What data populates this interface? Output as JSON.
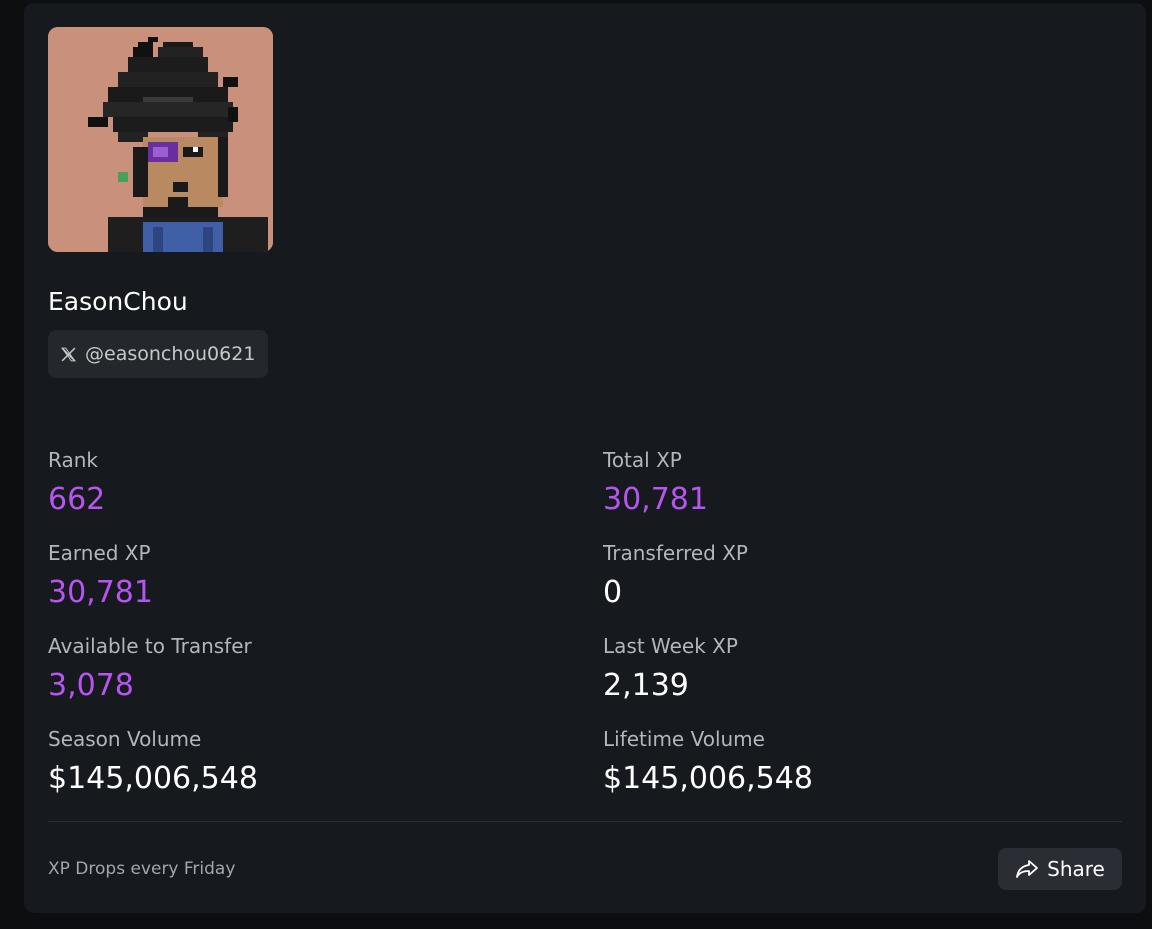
{
  "profile": {
    "avatar_icon": "pixel-art-avatar",
    "name": "EasonChou",
    "social": {
      "icon": "x-logo-icon",
      "handle": "@easonchou0621"
    }
  },
  "stats": {
    "rank": {
      "label": "Rank",
      "value": "662"
    },
    "total_xp": {
      "label": "Total XP",
      "value": "30,781"
    },
    "earned_xp": {
      "label": "Earned XP",
      "value": "30,781"
    },
    "transferred_xp": {
      "label": "Transferred XP",
      "value": "0"
    },
    "available_to_transfer": {
      "label": "Available to Transfer",
      "value": "3,078"
    },
    "last_week_xp": {
      "label": "Last Week XP",
      "value": "2,139"
    },
    "season_volume": {
      "label": "Season Volume",
      "value": "$145,006,548"
    },
    "lifetime_volume": {
      "label": "Lifetime Volume",
      "value": "$145,006,548"
    }
  },
  "footer": {
    "note": "XP Drops every Friday",
    "share_label": "Share",
    "share_icon": "share-arrow-icon"
  },
  "colors": {
    "page_bg": "#0d0e10",
    "card_bg": "#16191d",
    "accent_purple": "#b755f0",
    "label_gray": "#b3b6ba",
    "pill_bg": "#24272b",
    "button_bg": "#2b2d35"
  }
}
